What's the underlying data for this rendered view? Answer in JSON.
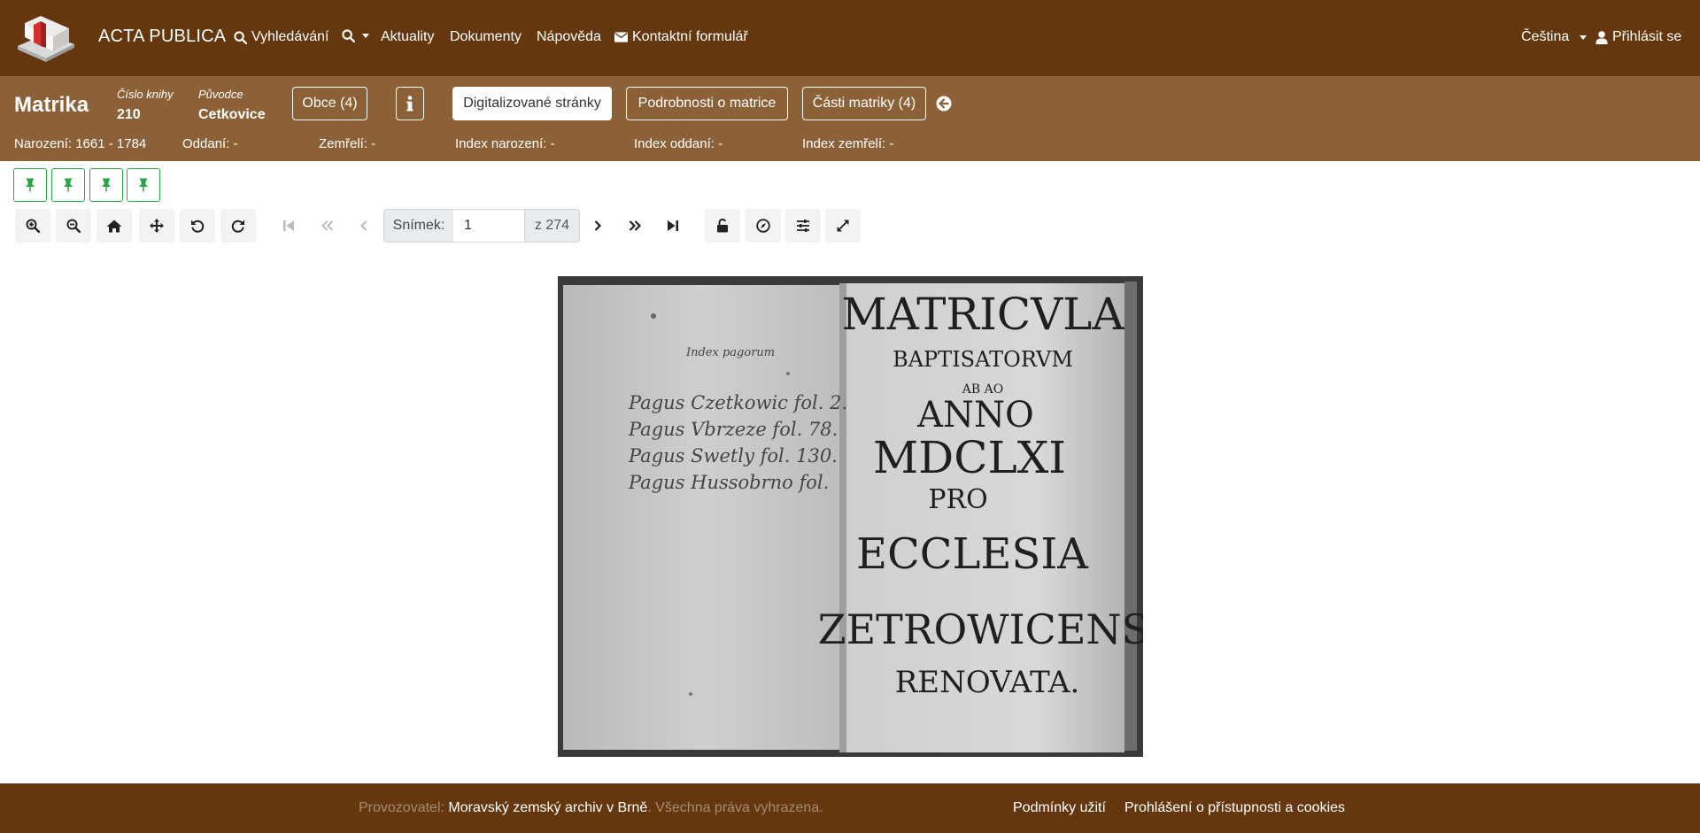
{
  "navbar": {
    "brand": "ACTA PUBLICA",
    "search_label": "Vyhledávání",
    "news_label": "Aktuality",
    "documents_label": "Dokumenty",
    "help_label": "Nápověda",
    "contact_label": "Kontaktní formulář",
    "language_label": "Čeština",
    "login_label": "Přihlásit se"
  },
  "record": {
    "title": "Matrika",
    "book_number_label": "Číslo knihy",
    "book_number": "210",
    "origin_label": "Původce",
    "origin": "Cetkovice",
    "municipalities_button": "Obce (4)",
    "info_icon": "info-icon",
    "tabs": [
      {
        "label": "Digitalizované stránky",
        "active": true
      },
      {
        "label": "Podrobnosti o matrice",
        "active": false
      },
      {
        "label": "Části matriky (4)",
        "active": false
      }
    ],
    "stats": {
      "births": "Narození: 1661 - 1784",
      "marriages": "Oddaní: -",
      "deaths": "Zemřelí: -",
      "birth_index": "Index narození: -",
      "marriage_index": "Index oddaní: -",
      "death_index": "Index zemřelí: -"
    }
  },
  "pins": [
    "pin-icon",
    "pin-icon",
    "pin-icon",
    "pin-icon"
  ],
  "viewer": {
    "frame_label": "Snímek:",
    "frame_value": "1",
    "frame_total": "z 274"
  },
  "scan": {
    "left_page_heading": "Index pagorum",
    "left_page_lines": [
      "Pagus Czetkowic fol. 2.",
      "Pagus Vbrzeze fol. 78.",
      "Pagus Swetly fol. 130.",
      "Pagus Hussobrno fol."
    ],
    "right_page_lines": [
      "MATRICVLA",
      "BAPTISATORVM",
      "AB AO",
      "ANNO",
      "MDCLXI",
      "PRO",
      "ECCLESIA",
      "ZETROWICENSI",
      "RENOVATA."
    ]
  },
  "footer": {
    "operator_label": "Provozovatel:",
    "operator_name": "Moravský zemský archiv v Brně",
    "rights": ". Všechna práva vyhrazena.",
    "terms_link": "Podmínky užití",
    "accessibility_link": "Prohlášení o přístupnosti a cookies"
  },
  "colors": {
    "navbar": "#65370e",
    "band": "#8d6138",
    "pin_green": "#28a745"
  }
}
